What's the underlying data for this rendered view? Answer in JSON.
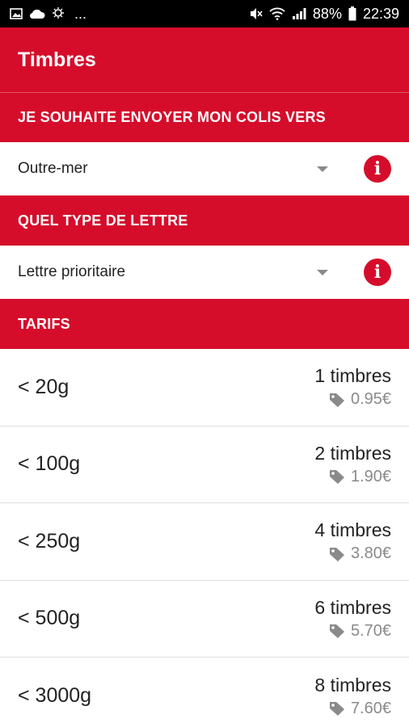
{
  "status_bar": {
    "ellipsis": "...",
    "battery": "88%",
    "time": "22:39",
    "icons": [
      "image-icon",
      "cloud-icon",
      "weather-icon",
      "mute-icon",
      "wifi-icon",
      "signal-icon",
      "battery-icon"
    ]
  },
  "app_bar": {
    "title": "Timbres"
  },
  "destination": {
    "header": "JE SOUHAITE ENVOYER MON COLIS VERS",
    "value": "Outre-mer"
  },
  "letter_type": {
    "header": "QUEL TYPE DE LETTRE",
    "value": "Lettre prioritaire"
  },
  "tarifs": {
    "header": "TARIFS",
    "rows": [
      {
        "weight": "< 20g",
        "stamps": "1 timbres",
        "price": "0.95€"
      },
      {
        "weight": "< 100g",
        "stamps": "2 timbres",
        "price": "1.90€"
      },
      {
        "weight": "< 250g",
        "stamps": "4 timbres",
        "price": "3.80€"
      },
      {
        "weight": "< 500g",
        "stamps": "6 timbres",
        "price": "5.70€"
      },
      {
        "weight": "< 3000g",
        "stamps": "8 timbres",
        "price": "7.60€"
      }
    ]
  },
  "colors": {
    "accent": "#d50d2b",
    "muted": "#8a8a8a"
  }
}
